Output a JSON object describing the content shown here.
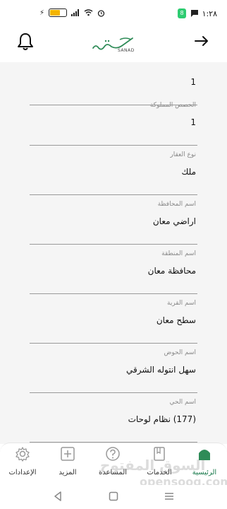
{
  "status_bar": {
    "time": "١:٢٨",
    "notif_badge": "8",
    "battery_level": 0.55,
    "battery_color": "#f4b400"
  },
  "header": {
    "brand_text": "SANAD",
    "bell_icon": "bell-icon",
    "back_icon": "arrow-right-icon",
    "brand_color": "#2e8b57"
  },
  "fields": [
    {
      "label": "",
      "value": "1"
    },
    {
      "label": "الحصص المملوكة",
      "value": "1"
    },
    {
      "label": "نوع العقار",
      "value": "ملك"
    },
    {
      "label": "اسم المحافظة",
      "value": "اراضي معان"
    },
    {
      "label": "اسم المنطقة",
      "value": "محافظة معان"
    },
    {
      "label": "اسم القرية",
      "value": "سطح معان"
    },
    {
      "label": "اسم الحوض",
      "value": "سهل انتوله الشرقي"
    },
    {
      "label": "اسم الحي",
      "value": "(177) نظام لوحات"
    }
  ],
  "bottom_nav": {
    "items": [
      {
        "label": "الإعدادات",
        "icon": "gear-icon"
      },
      {
        "label": "المزيد",
        "icon": "plus-square-icon"
      },
      {
        "label": "المساعدة",
        "icon": "question-icon"
      },
      {
        "label": "الخدمات",
        "icon": "document-icon"
      },
      {
        "label": "الرئيسية",
        "icon": "home-icon",
        "active": true
      }
    ],
    "active_color": "#2e8b57"
  },
  "watermark": {
    "arabic": "السوق المفتوح",
    "english": "opensooq.com"
  }
}
